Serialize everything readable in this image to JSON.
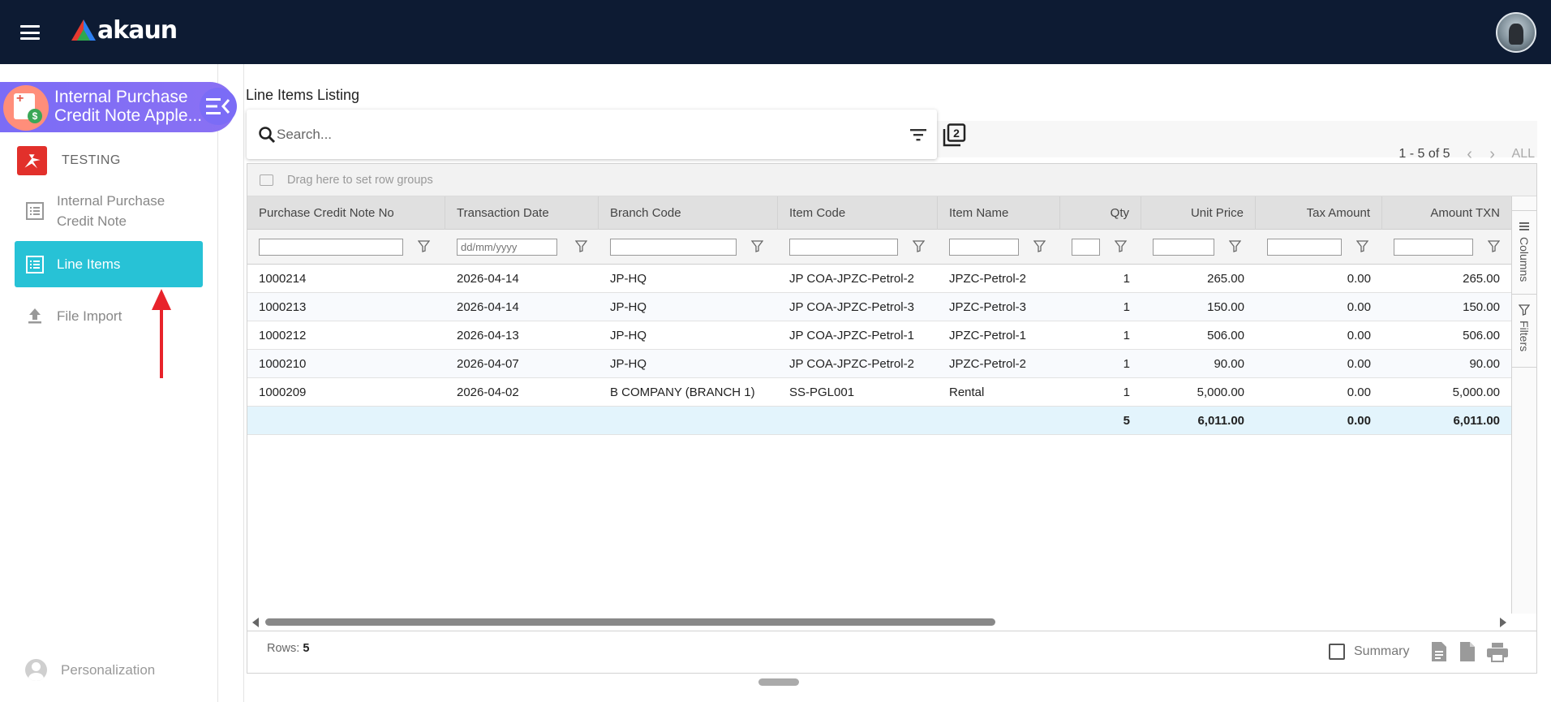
{
  "header": {
    "brand": "akaun",
    "colors": {
      "topbar": "#0d1b33",
      "accent": "#27c2d6",
      "app_pill": "#7b6cf6"
    }
  },
  "sidebar": {
    "app_title_line1": "Internal Purchase",
    "app_title_line2": "Credit Note Apple...",
    "org_name": "TESTING",
    "items": [
      {
        "label": "Internal Purchase Credit Note",
        "icon": "list-icon"
      },
      {
        "label": "Line Items",
        "icon": "list-icon",
        "active": true
      },
      {
        "label": "File Import",
        "icon": "upload-icon"
      }
    ],
    "personalization": "Personalization"
  },
  "main": {
    "title": "Line Items Listing",
    "search_placeholder": "Search...",
    "pagination": {
      "text": "1 - 5 of 5",
      "all_label": "ALL"
    },
    "group_panel_text": "Drag here to set row groups",
    "columns": [
      "Purchase Credit Note No",
      "Transaction Date",
      "Branch Code",
      "Item Code",
      "Item Name",
      "Qty",
      "Unit Price",
      "Tax Amount",
      "Amount TXN"
    ],
    "date_filter_placeholder": "dd/mm/yyyy",
    "rows": [
      [
        "1000214",
        "2026-04-14",
        "JP-HQ",
        "JP COA-JPZC-Petrol-2",
        "JPZC-Petrol-2",
        "1",
        "265.00",
        "0.00",
        "265.00"
      ],
      [
        "1000213",
        "2026-04-14",
        "JP-HQ",
        "JP COA-JPZC-Petrol-3",
        "JPZC-Petrol-3",
        "1",
        "150.00",
        "0.00",
        "150.00"
      ],
      [
        "1000212",
        "2026-04-13",
        "JP-HQ",
        "JP COA-JPZC-Petrol-1",
        "JPZC-Petrol-1",
        "1",
        "506.00",
        "0.00",
        "506.00"
      ],
      [
        "1000210",
        "2026-04-07",
        "JP-HQ",
        "JP COA-JPZC-Petrol-2",
        "JPZC-Petrol-2",
        "1",
        "90.00",
        "0.00",
        "90.00"
      ],
      [
        "1000209",
        "2026-04-02",
        "B COMPANY (BRANCH 1)",
        "SS-PGL001",
        "Rental",
        "1",
        "5,000.00",
        "0.00",
        "5,000.00"
      ]
    ],
    "totals": {
      "qty": "5",
      "unit_price": "6,011.00",
      "tax_amount": "0.00",
      "amount_txn": "6,011.00"
    },
    "side_tabs": {
      "columns": "Columns",
      "filters": "Filters"
    },
    "status": {
      "rows_label": "Rows:",
      "rows_count": "5",
      "summary_label": "Summary"
    }
  }
}
